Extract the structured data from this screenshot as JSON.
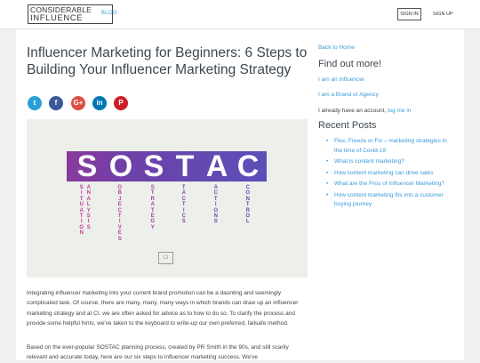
{
  "header": {
    "logo_line1": "CONSIDERABLE",
    "logo_line2": "INFLUENCE",
    "nav_blog": "BLOG",
    "sign_in": "SIGN IN",
    "sign_up": "SIGN UP"
  },
  "article": {
    "title": "Influencer Marketing for Beginners: 6 Steps to Building Your Influencer Marketing Strategy",
    "share_icons": [
      "twitter-icon",
      "facebook-icon",
      "google-plus-icon",
      "linkedin-icon",
      "pinterest-icon"
    ],
    "share_glyphs": [
      "t",
      "f",
      "G+",
      "in",
      "P"
    ],
    "hero": {
      "letters": [
        "S",
        "O",
        "S",
        "T",
        "A",
        "C"
      ],
      "words": [
        "SITUATION ANALYSIS",
        "OBJECTIVES",
        "STRATEGY",
        "TACTICS",
        "ACTIONS",
        "CONTROL"
      ],
      "logo": "CI"
    },
    "paragraph1": "Integrating influencer marketing into your current brand promotion can be a daunting and seemingly complicated task. Of course, there are many, many, many ways in which brands can draw up an influencer marketing strategy and at CI, we are often asked for advice as to how to do so. To clarify the process and provide some helpful hints, we've taken to the keyboard to write-up our own preferred, failsafe method.",
    "paragraph2": "Based on the ever-popular SOSTAC planning process, created by PR Smith in the 90s, and still scarily relevant and accurate today, here are our six steps to influencer marketing success. We've"
  },
  "sidebar": {
    "back_link": "Back to Home",
    "find_out_heading": "Find out more!",
    "influencer_link": "I am an Influencer",
    "brand_link": "I am a Brand or Agency",
    "account_text": "I already have an account,",
    "login_link": "log me in",
    "recent_heading": "Recent Posts",
    "recent_posts": [
      "Flex, Freeze or Fix – marketing strategies in the time of Covid-19",
      "What is content marketing?",
      "How content marketing can drive sales",
      "What are the Pros of Influencer Marketing?",
      "How content marketing fits into a customer buying journey"
    ]
  },
  "colors": {
    "accent": "#3a9ad9",
    "banner_start": "#8a3a9c",
    "banner_end": "#5c4fb8",
    "word_colors": [
      "#c0399a",
      "#b83e9f",
      "#9d42a6",
      "#7c46ad",
      "#6848b2",
      "#5a4bb8"
    ]
  }
}
